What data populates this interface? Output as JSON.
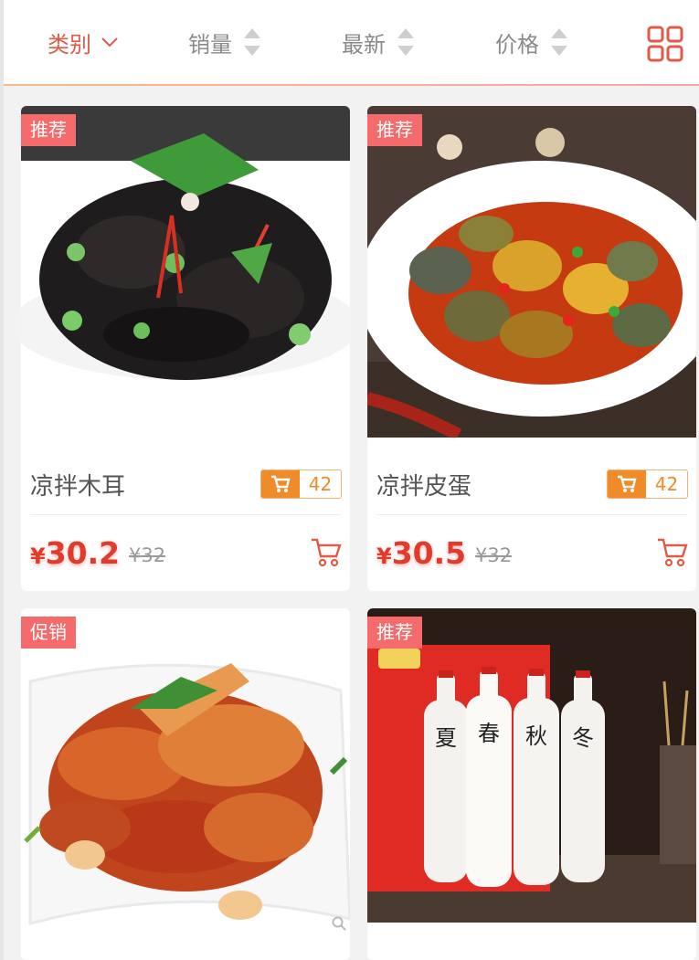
{
  "sort_bar": {
    "category": "类别",
    "sales": "销量",
    "newest": "最新",
    "price": "价格"
  },
  "colors": {
    "accent": "#e05a47",
    "orange": "#f08b2a",
    "badge": "#f56a6a",
    "price": "#e23b2b"
  },
  "products": [
    {
      "badge": "推荐",
      "name": "凉拌木耳",
      "cart_count": "42",
      "currency": "¥",
      "price": "30.2",
      "old_price": "¥32"
    },
    {
      "badge": "推荐",
      "name": "凉拌皮蛋",
      "cart_count": "42",
      "currency": "¥",
      "price": "30.5",
      "old_price": "¥32"
    },
    {
      "badge": "促销"
    },
    {
      "badge": "推荐",
      "bottle_chars": [
        "夏",
        "春",
        "秋",
        "冬"
      ]
    }
  ],
  "icons": [
    "chevron-down-icon",
    "sort-updown-icon",
    "grid-view-icon",
    "cart-icon",
    "add-to-cart-icon",
    "zoom-icon"
  ]
}
